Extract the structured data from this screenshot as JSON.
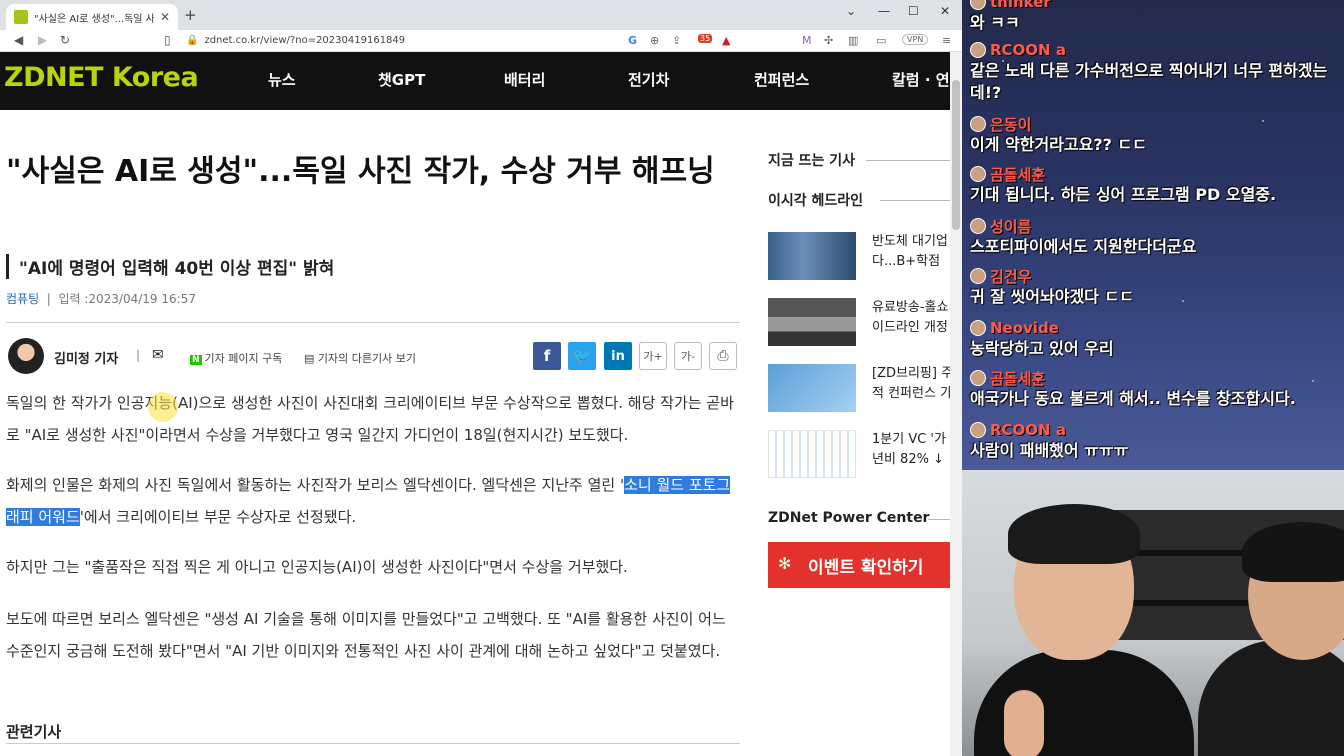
{
  "browser": {
    "tab_title": "\"사실은 AI로 생성\"...독일 사진 작",
    "url": "zdnet.co.kr/view/?no=20230419161849",
    "ext_badge": "35",
    "vpn_label": "VPN"
  },
  "site": {
    "logo": "ZDNET Korea",
    "menu": [
      "뉴스",
      "챗GPT",
      "배터리",
      "전기차",
      "컨퍼런스",
      "칼럼 · 연"
    ]
  },
  "article": {
    "headline": "\"사실은 AI로 생성\"...독일 사진 작가, 수상 거부 해프닝",
    "subhead": "\"AI에 명령어 입력해 40번 이상 편집\" 밝혀",
    "category": "컴퓨팅",
    "date": "입력 :2023/04/19 16:57",
    "author": "김미정 기자",
    "subscribe_label": "기자 페이지 구독",
    "other_articles_label": "기자의 다른기사 보기",
    "font_up": "가+",
    "font_down": "가-",
    "p1": "독일의 한 작가가 인공지능(AI)으로 생성한 사진이 사진대회 크리에이티브 부문 수상작으로 뽑혔다. 해당 작가는 곧바로 \"AI로 생성한 사진\"이라면서 수상을 거부했다고 영국 일간지 가디언이 18일(현지시간) 보도했다.",
    "p2_a": "화제의 인물은 화제의 사진 독일에서 활동하는 사진작가 보리스 엘닥센이다. 엘닥센은 지난주 열린 '",
    "p2_hl": "소니 월드 포토그래피 어워드",
    "p2_b": "'에서 크리에이티브 부문 수상자로 선정됐다.",
    "p3": "하지만 그는 \"출품작은 직접 찍은 게 아니고 인공지능(AI)이 생성한 사진이다\"면서 수상을 거부했다.",
    "p4": "보도에 따르면 보리스 엘닥센은 \"생성 AI 기술을 통해 이미지를 만들었다\"고 고백했다. 또 \"AI를 활용한 사진이 어느 수준인지 궁금해 도전해 봤다\"면서 \"AI 기반 이미지와 전통적인 사진 사이 관계에 대해 논하고 싶었다\"고 덧붙였다.",
    "related": "관련기사"
  },
  "sidebar": {
    "trending": "지금 뜨는 기사",
    "headlines": "이시각 헤드라인",
    "items": [
      {
        "line1": "반도체 대기업",
        "line2": "다...B+학점"
      },
      {
        "line1": "유료방송-홀쇼",
        "line2": "이드라인 개정"
      },
      {
        "line1": "[ZD브리핑] 주",
        "line2": "적 컨퍼런스 가"
      },
      {
        "line1": "1분기 VC '가",
        "line2": "년비 82% ↓"
      }
    ],
    "power_center": "ZDNet Power Center",
    "banner": "이벤트 확인하기"
  },
  "chat": [
    {
      "user": "thinker",
      "text": "와 ㅋㅋ"
    },
    {
      "user": "RCOON a",
      "text": "같은 노래 다른 가수버전으로 찍어내기 너무 편하겠는데!?"
    },
    {
      "user": "은동이",
      "text": "이게 약한거라고요?? ㄷㄷ"
    },
    {
      "user": "곰돌세훈",
      "text": "기대 됩니다. 하든 싱어 프로그램 PD 오열중."
    },
    {
      "user": "성이름",
      "text": "스포티파이에서도 지원한다더군요"
    },
    {
      "user": "김건우",
      "text": "귀 잘 씻어놔야겠다 ㄷㄷ"
    },
    {
      "user": "Neovide",
      "text": "농락당하고 있어 우리"
    },
    {
      "user": "곰돌세훈",
      "text": "애국가나 동요 불르게 해서.. 변수를 창조합시다."
    },
    {
      "user": "RCOON a",
      "text": "사람이 패배했어 ㅠㅠㅠ"
    }
  ]
}
